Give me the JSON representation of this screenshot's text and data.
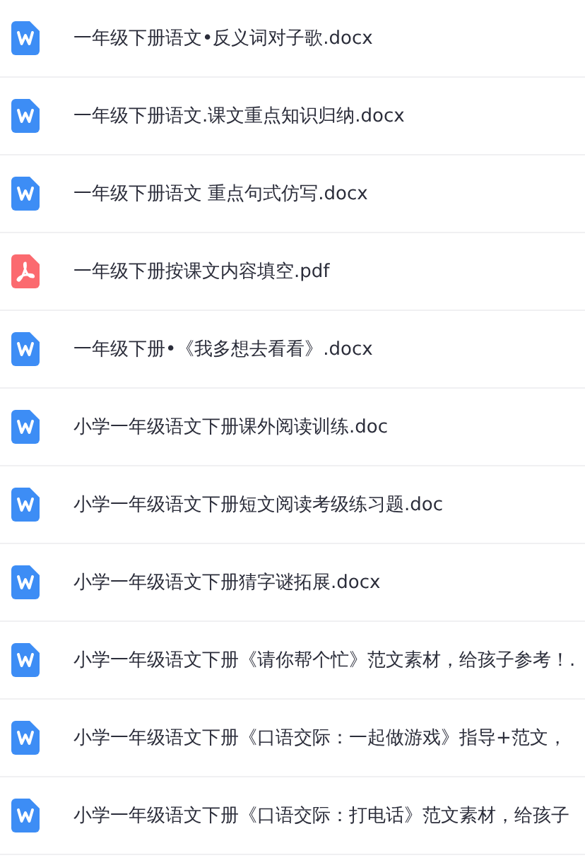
{
  "files": [
    {
      "name": "一年级下册语文•反义词对子歌.docx",
      "kind": "word"
    },
    {
      "name": "一年级下册语文.课文重点知识归纳.docx",
      "kind": "word"
    },
    {
      "name": "一年级下册语文 重点句式仿写.docx",
      "kind": "word"
    },
    {
      "name": "一年级下册按课文内容填空.pdf",
      "kind": "pdf"
    },
    {
      "name": "一年级下册•《我多想去看看》.docx",
      "kind": "word"
    },
    {
      "name": "小学一年级语文下册课外阅读训练.doc",
      "kind": "word"
    },
    {
      "name": "小学一年级语文下册短文阅读考级练习题.doc",
      "kind": "word"
    },
    {
      "name": "小学一年级语文下册猜字谜拓展.docx",
      "kind": "word"
    },
    {
      "name": "小学一年级语文下册《请你帮个忙》范文素材，给孩子参考！.",
      "kind": "word"
    },
    {
      "name": "小学一年级语文下册《口语交际：一起做游戏》指导+范文，",
      "kind": "word"
    },
    {
      "name": "小学一年级语文下册《口语交际：打电话》范文素材，给孩子",
      "kind": "word"
    }
  ]
}
